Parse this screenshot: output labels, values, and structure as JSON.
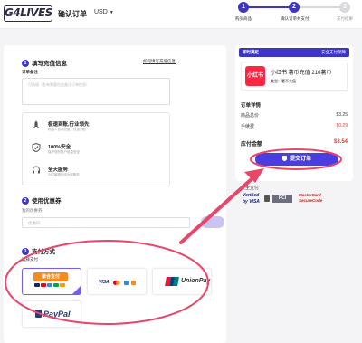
{
  "header": {
    "logo_text": "G4LIVES",
    "title": "确认订单",
    "currency": "USD",
    "steps": [
      {
        "num": "1",
        "label": "购买商品",
        "state": "done"
      },
      {
        "num": "2",
        "label": "确认订单并支付",
        "state": "done"
      },
      {
        "num": "3",
        "label": "支付结果",
        "state": "todo"
      }
    ]
  },
  "recharge": {
    "num": "1",
    "title": "填写充值信息",
    "guide_link": "如何填写充值信息",
    "remark_label": "订单备注",
    "remark_placeholder": "可选填（若有需要在此备注订单信息）"
  },
  "features": [
    {
      "icon": "rocket-icon",
      "title": "极速到账,行业领先",
      "desc": "机器人自动充值，快速到账"
    },
    {
      "icon": "shield-check-icon",
      "title": "100%安全",
      "desc": "保护您的账户信息安全"
    },
    {
      "icon": "headset-icon",
      "title": "全天服务",
      "desc": "24/7客服在线为您服务"
    }
  ],
  "coupon": {
    "num": "2",
    "title": "使用优惠券",
    "label": "我的优惠券",
    "placeholder": "优惠码"
  },
  "payment": {
    "num": "3",
    "title": "支付方式",
    "sub_label": "选择支付",
    "methods": [
      {
        "name": "mix-pay",
        "label": "聚合支付",
        "selected": true
      },
      {
        "name": "visa-mastercard",
        "label": "VISA",
        "selected": false
      },
      {
        "name": "unionpay",
        "label": "UnionPay",
        "selected": false
      },
      {
        "name": "paypal",
        "label": "PayPal",
        "selected": false
      }
    ]
  },
  "summary": {
    "header_left": "即时满足",
    "header_right": "安全支付保障",
    "product_icon_text": "小红书",
    "product_name": "小红书 薯币充值 210薯币",
    "product_type": "类型：薯币充值",
    "details_title": "订单详情",
    "rows": [
      {
        "label": "商品总价",
        "value": "$3.25",
        "red": false
      },
      {
        "label": "手续费",
        "value": "$0.29",
        "red": true
      }
    ],
    "total_label": "应付金额",
    "total_value": "$3.54",
    "submit_label": "提交订单"
  },
  "security": {
    "label": "安全支付",
    "badges": [
      "Verified by VISA",
      "PCI",
      "MasterCard SecureCode"
    ]
  },
  "colors": {
    "accent": "#3d35c8",
    "annotation": "#e8476a",
    "price_red": "#e53935"
  }
}
